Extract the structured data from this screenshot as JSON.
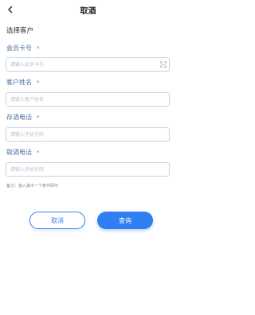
{
  "header": {
    "title": "取酒",
    "back_icon": "chevron-left-icon"
  },
  "section_title": "选择客户",
  "fields": [
    {
      "label": "会员卡号",
      "placeholder": "请输入会员卡号",
      "required": "*"
    },
    {
      "label": "客户姓名",
      "placeholder": "请输入客户姓名",
      "required": "*"
    },
    {
      "label": "存酒电话",
      "placeholder": "请输入手机号码",
      "required": "*"
    },
    {
      "label": "取酒电话",
      "placeholder": "请输入手机号码",
      "required": "*"
    }
  ],
  "scan_icon": "scan-icon",
  "note": "备注：输入其中一个条件即可",
  "buttons": {
    "cancel": "取消",
    "query": "查询"
  },
  "colors": {
    "label": "#4a6fa0",
    "primary": "#2f7ff2",
    "border": "#c9d3e3"
  }
}
